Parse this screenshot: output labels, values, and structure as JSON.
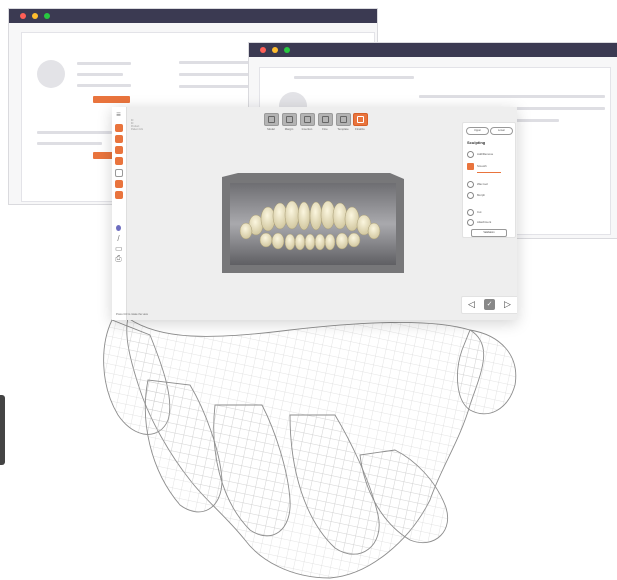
{
  "app": {
    "info_lines": [
      "ID",
      "ID",
      "Product",
      "Patient Info"
    ],
    "toolbar": [
      {
        "label": "Model",
        "icon": "model-icon",
        "active": false
      },
      {
        "label": "Margin",
        "icon": "margin-icon",
        "active": false
      },
      {
        "label": "Insertion",
        "icon": "insertion-icon",
        "active": false
      },
      {
        "label": "Fine",
        "icon": "fine-icon",
        "active": false
      },
      {
        "label": "Template",
        "icon": "template-icon",
        "active": false
      },
      {
        "label": "Finalize",
        "icon": "finalize-icon",
        "active": true
      }
    ],
    "panel": {
      "tabs": [
        "Upper",
        "Lower"
      ],
      "title": "Sculpting",
      "rows": [
        {
          "label": "Add/Remove",
          "icon": "brush-icon"
        },
        {
          "label": "Smooth",
          "icon": "smooth-icon"
        },
        {
          "label": "Wax tool",
          "icon": "wax-icon"
        },
        {
          "label": "Morph",
          "icon": "morph-icon"
        },
        {
          "label": "Cut",
          "icon": "cut-icon"
        },
        {
          "label": "Attachment",
          "icon": "attachment-icon"
        }
      ],
      "apply_label": "Validation"
    },
    "hint": "Press Ctrl to rotate the view"
  },
  "colors": {
    "accent": "#e9743d",
    "window_bar": "#3b3a52"
  }
}
